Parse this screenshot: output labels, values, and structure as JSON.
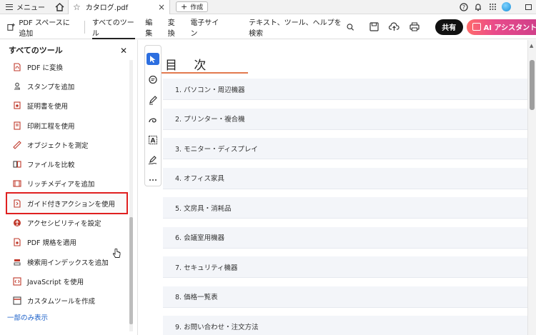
{
  "titlebar": {
    "menu_label": "メニュー",
    "tab_title": "カタログ.pdf",
    "new_tab_label": "作成"
  },
  "toolbar": {
    "pdf_space_label": "PDF スペースに追加",
    "tabs": [
      "すべてのツール",
      "編集",
      "変換",
      "電子サイン"
    ],
    "search_label": "テキスト、ツール、ヘルプを検索",
    "share_label": "共有",
    "ai_label": "AI アシスタントに質"
  },
  "left_panel": {
    "title": "すべてのツール",
    "items": [
      {
        "label": "PDF に変換",
        "icon": "pdf-convert-icon"
      },
      {
        "label": "スタンプを追加",
        "icon": "stamp-icon"
      },
      {
        "label": "証明書を使用",
        "icon": "certificate-icon"
      },
      {
        "label": "印刷工程を使用",
        "icon": "print-production-icon"
      },
      {
        "label": "オブジェクトを測定",
        "icon": "measure-icon"
      },
      {
        "label": "ファイルを比較",
        "icon": "compare-icon"
      },
      {
        "label": "リッチメディアを追加",
        "icon": "rich-media-icon"
      },
      {
        "label": "ガイド付きアクションを使用",
        "icon": "guided-action-icon"
      },
      {
        "label": "アクセシビリティを設定",
        "icon": "accessibility-icon"
      },
      {
        "label": "PDF 規格を適用",
        "icon": "pdf-standard-icon"
      },
      {
        "label": "検索用インデックスを追加",
        "icon": "index-icon"
      },
      {
        "label": "JavaScript を使用",
        "icon": "javascript-icon"
      },
      {
        "label": "カスタムツールを作成",
        "icon": "custom-tool-icon"
      }
    ],
    "highlighted_index": 7,
    "footer_link": "一部のみ表示"
  },
  "document": {
    "title": "目 次",
    "toc": [
      "1. パソコン・周辺機器",
      "2. プリンター・複合機",
      "3. モニター・ディスプレイ",
      "4. オフィス家具",
      "5. 文房具・消耗品",
      "6. 会議室用機器",
      "7. セキュリティ機器",
      "8. 価格一覧表",
      "9. お問い合わせ・注文方法"
    ]
  },
  "colors": {
    "accent_blue": "#2d6fe0",
    "highlight_red": "#e02020",
    "title_underline": "#e27a4e",
    "link_blue": "#1a5fc9"
  }
}
